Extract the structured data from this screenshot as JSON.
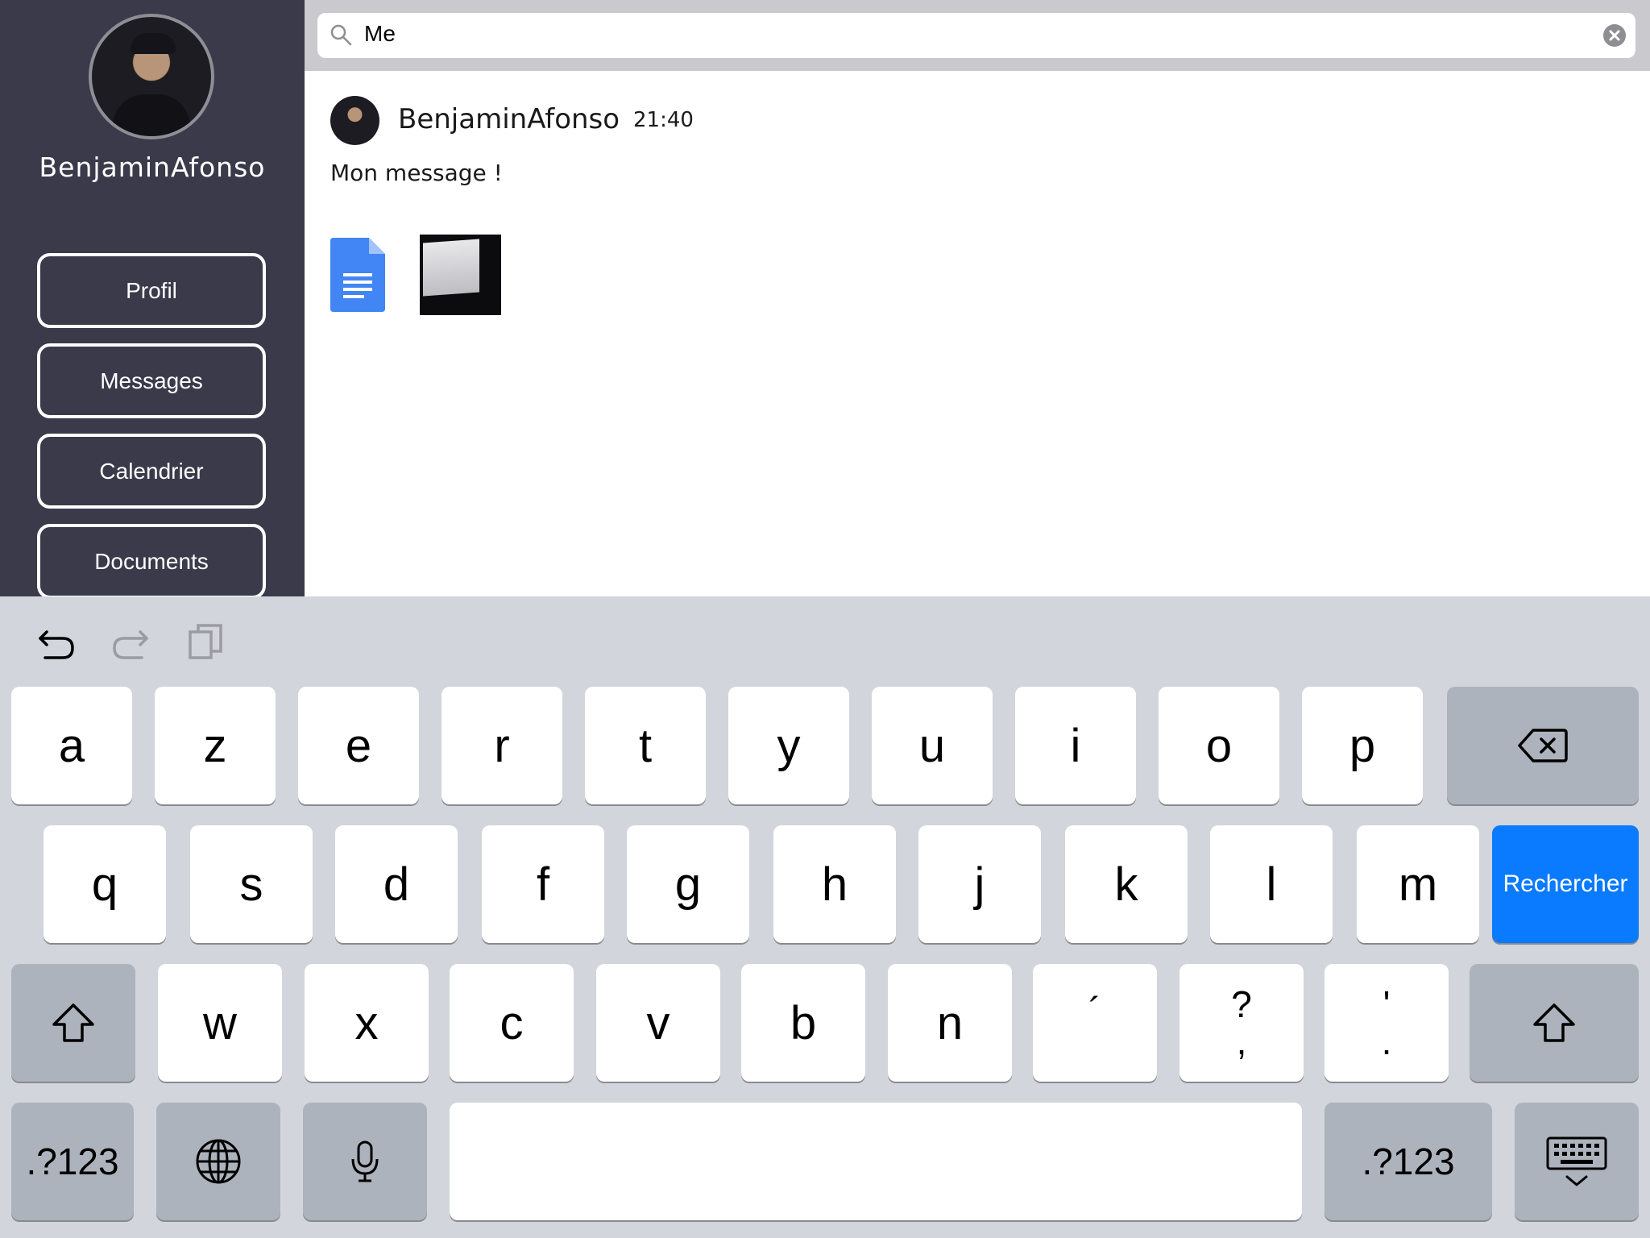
{
  "sidebar": {
    "username": "BenjaminAfonso",
    "nav": [
      "Profil",
      "Messages",
      "Calendrier",
      "Documents"
    ]
  },
  "search": {
    "value": "Me",
    "icon": "search-icon",
    "clear_icon": "clear-icon"
  },
  "message": {
    "author": "BenjaminAfonso",
    "time": "21:40",
    "text": "Mon message !",
    "attachments": [
      "document-icon",
      "image-thumbnail"
    ]
  },
  "keyboard": {
    "toolbar": [
      "undo-icon",
      "redo-icon",
      "paste-icon"
    ],
    "row1": [
      "a",
      "z",
      "e",
      "r",
      "t",
      "y",
      "u",
      "i",
      "o",
      "p"
    ],
    "row2": [
      "q",
      "s",
      "d",
      "f",
      "g",
      "h",
      "j",
      "k",
      "l",
      "m"
    ],
    "row3": [
      "w",
      "x",
      "c",
      "v",
      "b",
      "n"
    ],
    "row3_punct": [
      {
        "top": "´",
        "bottom": ""
      },
      {
        "top": "?",
        "bottom": ","
      },
      {
        "top": "'",
        "bottom": "."
      }
    ],
    "search_key": "Rechercher",
    "numbers_key": ".?123",
    "accent_color": "#0a7aff"
  }
}
